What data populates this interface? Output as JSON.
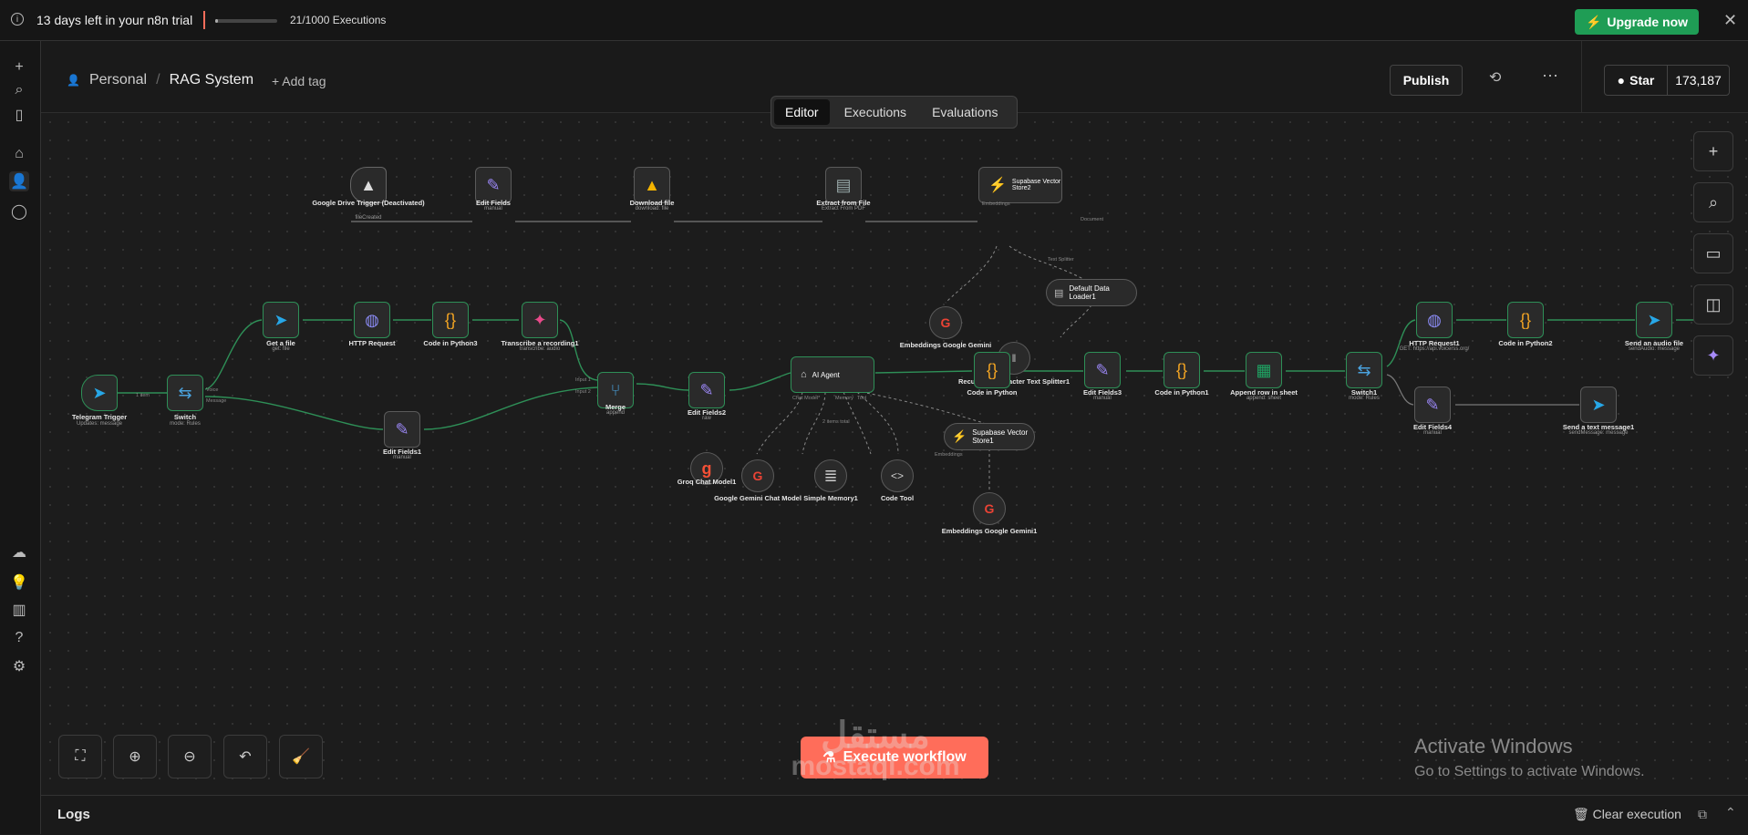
{
  "banner": {
    "trial_text": "13 days left in your n8n trial",
    "executions_text": "21/1000 Executions",
    "executions_progress": 0.021,
    "upgrade_label": "Upgrade now"
  },
  "header": {
    "project": "Personal",
    "workflow_name": "RAG System",
    "add_tag": "+ Add tag",
    "publish_label": "Publish",
    "github_star": "Star",
    "github_count": "173,187"
  },
  "tabs": [
    "Editor",
    "Executions",
    "Evaluations"
  ],
  "active_tab": "Editor",
  "nodes": {
    "gdrive": {
      "label": "Google Drive Trigger (Deactivated)",
      "sub": "fileCreated"
    },
    "editfields": {
      "label": "Edit Fields",
      "sub": "manual"
    },
    "download": {
      "label": "Download file",
      "sub": "download: file"
    },
    "extract": {
      "label": "Extract from File",
      "sub": "Extract From PDF"
    },
    "supabase2": {
      "label": "Supabase Vector Store2"
    },
    "emb_gemini": {
      "label": "Embeddings Google Gemini"
    },
    "dataloader": {
      "label": "Default Data Loader1"
    },
    "splitter": {
      "label": "Recursive Character Text Splitter1"
    },
    "tg_trigger": {
      "label": "Telegram Trigger",
      "sub": "Updates: message"
    },
    "switch": {
      "label": "Switch",
      "sub": "mode: Rules"
    },
    "getfile": {
      "label": "Get a file",
      "sub": "get: file"
    },
    "http": {
      "label": "HTTP Request"
    },
    "py3": {
      "label": "Code in Python3"
    },
    "transcribe": {
      "label": "Transcribe a recording1",
      "sub": "transcribe: audio"
    },
    "editfields1": {
      "label": "Edit Fields1",
      "sub": "manual"
    },
    "merge": {
      "label": "Merge",
      "sub": "append"
    },
    "editfields2": {
      "label": "Edit Fields2",
      "sub": "raw"
    },
    "agent": {
      "label": "AI Agent"
    },
    "groq": {
      "label": "Groq Chat Model1"
    },
    "gemini_chat": {
      "label": "Google Gemini Chat Model"
    },
    "memory": {
      "label": "Simple Memory1"
    },
    "codetool": {
      "label": "Code Tool"
    },
    "supabase1": {
      "label": "Supabase Vector Store1"
    },
    "emb_gemini1": {
      "label": "Embeddings Google Gemini1"
    },
    "py": {
      "label": "Code in Python"
    },
    "editfields3": {
      "label": "Edit Fields3",
      "sub": "manual"
    },
    "py1": {
      "label": "Code in Python1"
    },
    "sheet": {
      "label": "Append row in sheet",
      "sub": "append: sheet"
    },
    "switch1": {
      "label": "Switch1",
      "sub": "mode: Rules"
    },
    "http1": {
      "label": "HTTP Request1",
      "sub": "GET: https://api.voicerss.org/"
    },
    "py2": {
      "label": "Code in Python2"
    },
    "sendaudio": {
      "label": "Send an audio file",
      "sub": "sendAudio: message"
    },
    "editfields4": {
      "label": "Edit Fields4",
      "sub": "manual"
    },
    "sendtext": {
      "label": "Send a text message1",
      "sub": "sendMessage: message"
    }
  },
  "edge_labels": {
    "item": "1 item",
    "items2": "2 items total",
    "voice": "Voice",
    "message": "Message",
    "input1": "Input 1",
    "input2": "Input 2",
    "embeddings": "Embeddings",
    "document": "Document",
    "text_splitter": "Text Splitter",
    "chat_model": "Chat Model*",
    "memory": "Memory",
    "tool": "Tool",
    "model": "Model",
    "audio": "audio"
  },
  "execute_label": "Execute workflow",
  "watermark": {
    "arabic": "مستقل",
    "latin": "mostaql.com"
  },
  "windows": {
    "line1": "Activate Windows",
    "line2": "Go to Settings to activate Windows."
  },
  "logs": {
    "title": "Logs",
    "clear": "Clear execution"
  },
  "colors": {
    "accent": "#ff6d5a",
    "success": "#1f9d55",
    "telegram": "#27a7e7",
    "code": "#f5a623"
  }
}
